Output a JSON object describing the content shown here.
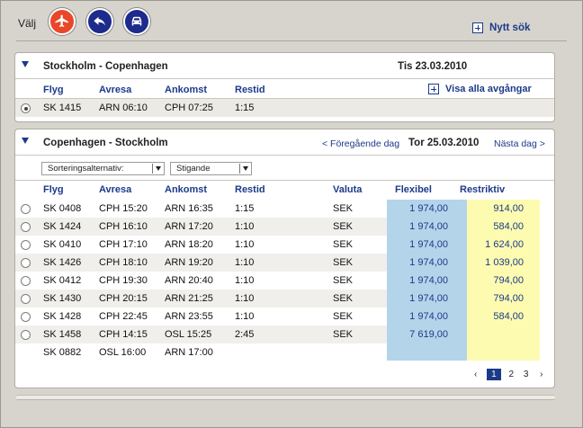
{
  "header": {
    "choose_label": "Välj",
    "modes": [
      "plane-icon",
      "ferry-icon",
      "car-icon"
    ],
    "new_search_label": "Nytt sök"
  },
  "outbound": {
    "route": "Stockholm - Copenhagen",
    "date": "Tis 23.03.2010",
    "show_all_label": "Visa alla avgångar",
    "columns": [
      "Flyg",
      "Avresa",
      "Ankomst",
      "Restid"
    ],
    "selected_flight": {
      "flight": "SK 1415",
      "depart": "ARN 06:10",
      "arrive": "CPH 07:25",
      "duration": "1:15"
    }
  },
  "return": {
    "route": "Copenhagen - Stockholm",
    "prev_day_label": "< Föregående dag",
    "date": "Tor 25.03.2010",
    "next_day_label": "Nästa dag >",
    "sort_select": "Sorteringsalternativ:",
    "order_select": "Stigande",
    "columns": [
      "Flyg",
      "Avresa",
      "Ankomst",
      "Restid",
      "Valuta",
      "Flexibel",
      "Restriktiv"
    ],
    "flights": [
      {
        "flight": "SK 0408",
        "depart": "CPH 15:20",
        "arrive": "ARN 16:35",
        "duration": "1:15",
        "currency": "SEK",
        "flexible": "1 974,00",
        "restricted": "914,00"
      },
      {
        "flight": "SK 1424",
        "depart": "CPH 16:10",
        "arrive": "ARN 17:20",
        "duration": "1:10",
        "currency": "SEK",
        "flexible": "1 974,00",
        "restricted": "584,00"
      },
      {
        "flight": "SK 0410",
        "depart": "CPH 17:10",
        "arrive": "ARN 18:20",
        "duration": "1:10",
        "currency": "SEK",
        "flexible": "1 974,00",
        "restricted": "1 624,00"
      },
      {
        "flight": "SK 1426",
        "depart": "CPH 18:10",
        "arrive": "ARN 19:20",
        "duration": "1:10",
        "currency": "SEK",
        "flexible": "1 974,00",
        "restricted": "1 039,00"
      },
      {
        "flight": "SK 0412",
        "depart": "CPH 19:30",
        "arrive": "ARN 20:40",
        "duration": "1:10",
        "currency": "SEK",
        "flexible": "1 974,00",
        "restricted": "794,00"
      },
      {
        "flight": "SK 1430",
        "depart": "CPH 20:15",
        "arrive": "ARN 21:25",
        "duration": "1:10",
        "currency": "SEK",
        "flexible": "1 974,00",
        "restricted": "794,00"
      },
      {
        "flight": "SK 1428",
        "depart": "CPH 22:45",
        "arrive": "ARN 23:55",
        "duration": "1:10",
        "currency": "SEK",
        "flexible": "1 974,00",
        "restricted": "584,00"
      },
      {
        "flight": "SK 1458",
        "depart": "CPH 14:15",
        "arrive": "OSL 15:25",
        "duration": "2:45",
        "currency": "SEK",
        "flexible": "7 619,00",
        "restricted": ""
      },
      {
        "flight": "SK 0882",
        "depart": "OSL 16:00",
        "arrive": "ARN 17:00",
        "duration": "",
        "currency": "",
        "flexible": "",
        "restricted": ""
      }
    ],
    "pager": {
      "prev": "‹",
      "pages": [
        "1",
        "2",
        "3"
      ],
      "current": "1",
      "next": "›"
    }
  },
  "colors": {
    "flexible_bg": "#b4d4ea",
    "restricted_bg": "#fdfbb0",
    "link": "#1c3a8a",
    "plane_button": "#e9472a"
  }
}
